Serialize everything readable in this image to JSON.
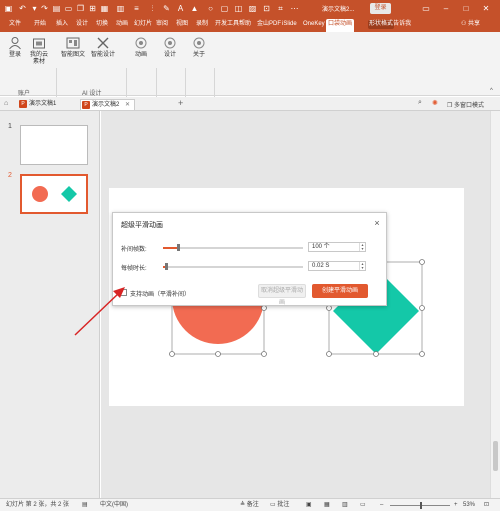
{
  "titlebar": {
    "doc_title": "演示文稿2...",
    "login_label": "登录"
  },
  "menu": {
    "tabs": [
      "文件",
      "开始",
      "插入",
      "设计",
      "切换",
      "动画",
      "幻灯片",
      "审阅",
      "视图",
      "录制",
      "开发工具",
      "帮助",
      "金山PDF",
      "iSlide",
      "OneKey",
      "口袋动画",
      "形状格式"
    ],
    "active_tab": "口袋动画",
    "search_label": "告诉我",
    "share_label": "共享"
  },
  "ribbon": {
    "login_label": "登录",
    "material_label": "我的云素材",
    "account_group": "账户",
    "smart_fig_label": "智能图文",
    "smart_design_label": "智能设计",
    "ai_group": "AI 设计",
    "anim_label": "动画",
    "design_label": "设计",
    "about_label": "关于"
  },
  "doc_tabs": [
    {
      "label": "演示文稿1",
      "active": false
    },
    {
      "label": "演示文稿2",
      "active": true
    }
  ],
  "tabbar": {
    "multi_window_label": "多窗口模式"
  },
  "thumbnails": [
    {
      "number": "1",
      "selected": false
    },
    {
      "number": "2",
      "selected": true
    }
  ],
  "dialog": {
    "title": "超级平滑动画",
    "tween_frames_label": "补间帧数:",
    "tween_frames_value": "100 个",
    "tween_frames_level": 0.11,
    "frame_time_label": "每帧时长:",
    "frame_time_value": "0.02 S",
    "frame_time_level": 0.02,
    "checkbox_label": "支持动画（平滑补间）",
    "checkbox_checked": false,
    "cancel_button": "取消超级平滑动画",
    "create_button": "创建平滑动画"
  },
  "statusbar": {
    "slide_info": "幻灯片 第 2 张，共 2 张",
    "language": "中文(中国)",
    "notes_label": "备注",
    "comments_label": "批注",
    "zoom_level": "53%"
  },
  "colors": {
    "accent": "#c5512a",
    "shape_circle": "#f26b52",
    "shape_diamond": "#14c8a8",
    "arrow": "#d82424"
  }
}
